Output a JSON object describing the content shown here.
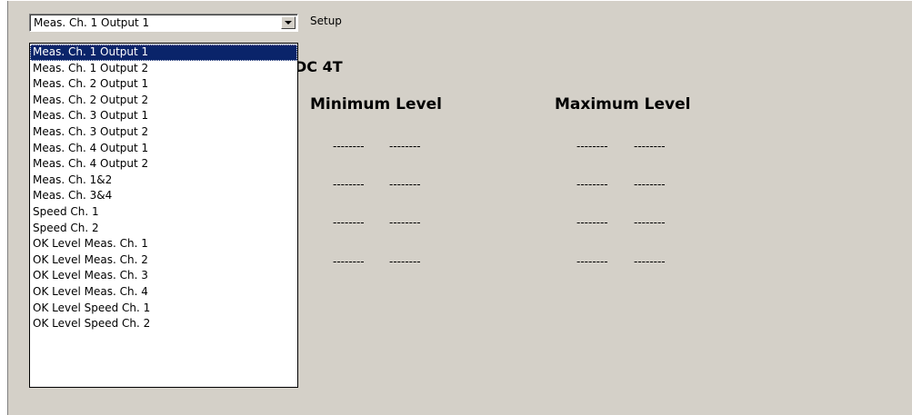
{
  "combo": {
    "selected_value": "Meas. Ch. 1 Output 1"
  },
  "setup_label": "Setup",
  "dropdown": {
    "options": [
      "Meas. Ch. 1 Output 1",
      "Meas. Ch. 1 Output 2",
      "Meas. Ch. 2 Output 1",
      "Meas. Ch. 2 Output 2",
      "Meas. Ch. 3 Output 1",
      "Meas. Ch. 3 Output 2",
      "Meas. Ch. 4 Output 1",
      "Meas. Ch. 4 Output 2",
      "Meas. Ch. 1&2",
      "Meas. Ch. 3&4",
      "Speed Ch. 1",
      "Speed Ch. 2",
      "OK Level Meas. Ch. 1",
      "OK Level Meas. Ch. 2",
      "OK Level Meas. Ch. 3",
      "OK Level Meas. Ch. 4",
      "OK Level Speed Ch. 1",
      "OK Level Speed Ch. 2"
    ],
    "highlighted_index": 0
  },
  "header_partial": "DC 4T",
  "columns": {
    "minimum_label": "Minimum Level",
    "maximum_label": "Maximum Level"
  },
  "rows": [
    {
      "min_a": "--------",
      "min_b": "--------",
      "max_a": "--------",
      "max_b": "--------"
    },
    {
      "min_a": "--------",
      "min_b": "--------",
      "max_a": "--------",
      "max_b": "--------"
    },
    {
      "min_a": "--------",
      "min_b": "--------",
      "max_a": "--------",
      "max_b": "--------"
    },
    {
      "min_a": "--------",
      "min_b": "--------",
      "max_a": "--------",
      "max_b": "--------"
    }
  ]
}
